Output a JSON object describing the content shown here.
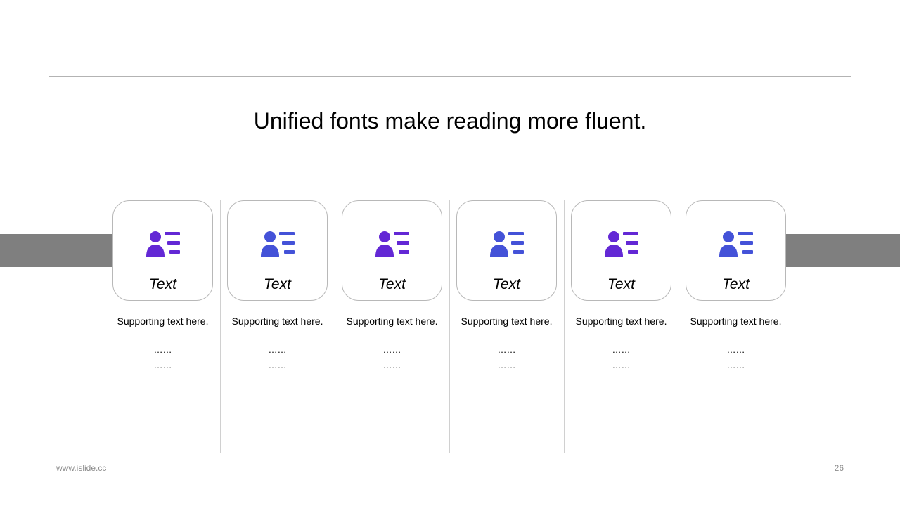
{
  "title": "Unified fonts make reading more fluent.",
  "icon_name": "user-list-icon",
  "colors": {
    "accent_purple": "#6328D5",
    "accent_indigo": "#4452D8",
    "band_gray": "#7F7F7F"
  },
  "items": [
    {
      "label": "Text",
      "support": "Supporting text here.",
      "dots1": "……",
      "dots2": "……",
      "icon_color": "#6328D5"
    },
    {
      "label": "Text",
      "support": "Supporting text here.",
      "dots1": "……",
      "dots2": "……",
      "icon_color": "#4452D8"
    },
    {
      "label": "Text",
      "support": "Supporting text here.",
      "dots1": "……",
      "dots2": "……",
      "icon_color": "#6328D5"
    },
    {
      "label": "Text",
      "support": "Supporting text here.",
      "dots1": "……",
      "dots2": "……",
      "icon_color": "#4452D8"
    },
    {
      "label": "Text",
      "support": "Supporting text here.",
      "dots1": "……",
      "dots2": "……",
      "icon_color": "#6328D5"
    },
    {
      "label": "Text",
      "support": "Supporting text here.",
      "dots1": "……",
      "dots2": "……",
      "icon_color": "#4452D8"
    }
  ],
  "footer": {
    "website": "www.islide.cc",
    "page_number": "26"
  }
}
